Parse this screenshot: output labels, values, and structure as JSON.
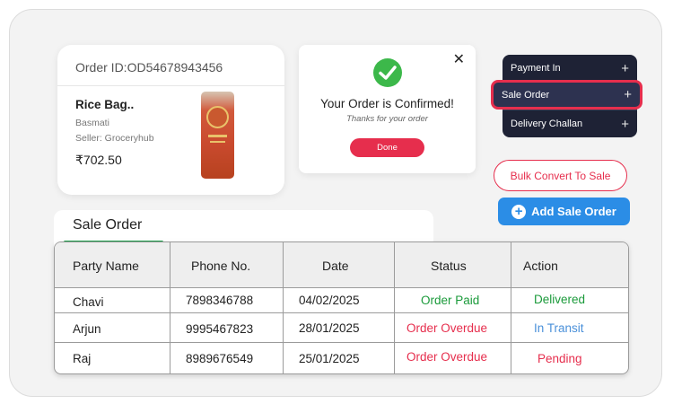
{
  "order_card": {
    "order_id": "Order ID:OD54678943456",
    "product_name": "Rice Bag..",
    "variant": "Basmati",
    "seller": "Seller:  Groceryhub",
    "price": "₹702.50"
  },
  "confirmation": {
    "title": "Your Order is Confirmed!",
    "subtitle": "Thanks for your order",
    "done_label": "Done",
    "close_glyph": "✕"
  },
  "menu": {
    "items": [
      {
        "label": "Payment In",
        "icon": "+"
      },
      {
        "label": "Sale Order",
        "icon": "+"
      },
      {
        "label": "Delivery Challan",
        "icon": "+"
      }
    ]
  },
  "actions": {
    "bulk_convert": "Bulk Convert To Sale",
    "add_sale_order": "Add Sale Order",
    "add_icon": "+"
  },
  "tab": {
    "label": "Sale Order"
  },
  "table": {
    "headers": [
      "Party Name",
      "Phone No.",
      "Date",
      "Status",
      "Action"
    ],
    "rows": [
      {
        "party": "Chavi",
        "phone": "7898346788",
        "date": "04/02/2025",
        "status": "Order Paid",
        "action": "Delivered"
      },
      {
        "party": "Arjun",
        "phone": "9995467823",
        "date": "28/01/2025",
        "status": "Order Overdue",
        "action": "In Transit"
      },
      {
        "party": "Raj",
        "phone": "8989676549",
        "date": "25/01/2025",
        "status": "Order Overdue",
        "action": "Pending"
      }
    ]
  },
  "colors": {
    "accent_red": "#e62e4d",
    "accent_blue": "#2b8de6",
    "success_green": "#1a9a3a",
    "menu_dark": "#1e2235"
  }
}
